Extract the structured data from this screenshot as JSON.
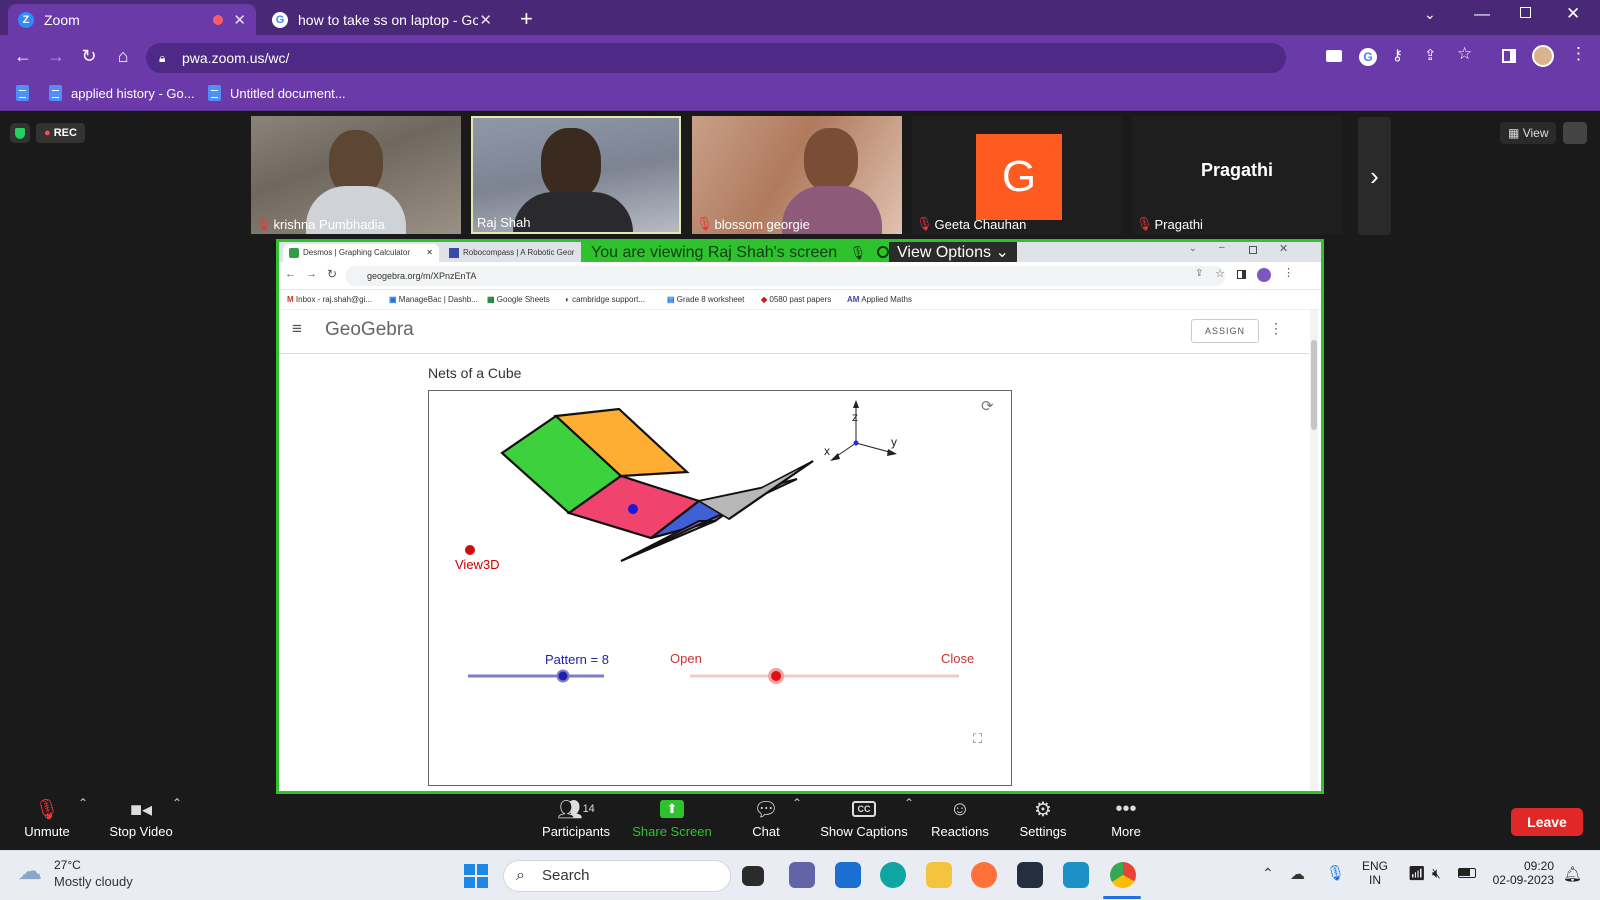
{
  "browser": {
    "tabs": [
      {
        "title": "Zoom",
        "favicon": "Z"
      },
      {
        "title": "how to take ss on laptop - Googl",
        "favicon": "G"
      }
    ],
    "new_tab_icon": "plus-icon",
    "url": "pwa.zoom.us/wc/",
    "bookmarks": [
      {
        "label": "applied history - Go..."
      },
      {
        "label": "Untitled document..."
      }
    ]
  },
  "meeting": {
    "rec_label": "REC",
    "view_label": "View",
    "participants": [
      {
        "name": "krishna Pumbhadia",
        "muted": true
      },
      {
        "name": "Raj Shah",
        "muted": false
      },
      {
        "name": "blossom georgie",
        "muted": true
      },
      {
        "name": "Geeta Chauhan",
        "muted": true,
        "avatar_letter": "G"
      },
      {
        "name": "Pragathi",
        "muted": true,
        "display_name": "Pragathi"
      }
    ],
    "banner": "You are viewing Raj Shah's screen",
    "view_options": "View Options"
  },
  "shared": {
    "tabs": [
      {
        "title": "Desmos | Graphing Calculator"
      },
      {
        "title": "Robocompass | A Robotic Geor"
      }
    ],
    "url": "geogebra.org/m/XPnzEnTA",
    "bookmarks": [
      "Inbox - raj.shah@gi...",
      "ManageBac | Dashb...",
      "Google Sheets",
      "cambridge support...",
      "Grade 8 worksheet",
      "0580 past papers",
      "Applied Maths"
    ],
    "logo": "GeoGebra",
    "assign": "ASSIGN",
    "page_title": "Nets of a Cube",
    "applet": {
      "view_label": "View3D",
      "pattern_label": "Pattern = 8",
      "pattern_value": 8,
      "open_label": "Open",
      "close_label": "Close",
      "fold_fraction": 0.32,
      "axes": {
        "x": "x",
        "y": "y",
        "z": "z"
      }
    }
  },
  "controls": [
    {
      "label": "Unmute",
      "icon": "microphone-muted-icon"
    },
    {
      "label": "Stop Video",
      "icon": "video-camera-icon"
    },
    {
      "label": "Participants",
      "icon": "participants-icon",
      "count": "14"
    },
    {
      "label": "Share Screen",
      "icon": "share-screen-icon"
    },
    {
      "label": "Chat",
      "icon": "chat-icon"
    },
    {
      "label": "Show Captions",
      "icon": "captions-icon"
    },
    {
      "label": "Reactions",
      "icon": "reactions-icon"
    },
    {
      "label": "Settings",
      "icon": "gear-icon"
    },
    {
      "label": "More",
      "icon": "more-icon"
    }
  ],
  "leave_label": "Leave",
  "taskbar": {
    "weather_temp": "27°C",
    "weather_desc": "Mostly cloudy",
    "search": "Search",
    "lang1": "ENG",
    "lang2": "IN",
    "time": "09:20",
    "date": "02-09-2023"
  },
  "colors": {
    "chrome_purple": "#6a3aa8",
    "active_speaker": "#2ec32e",
    "leave_red": "#e02828"
  }
}
